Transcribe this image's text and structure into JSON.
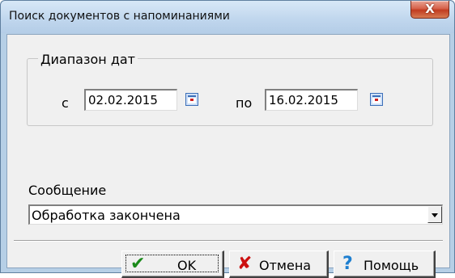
{
  "window": {
    "title": "Поиск документов с напоминаниями",
    "close_glyph": "X"
  },
  "date_range": {
    "group_label": "Диапазон дат",
    "from_label": "с",
    "from_value": "02.02.2015",
    "to_label": "по",
    "to_value": "16.02.2015",
    "calendar_icon": "calendar-icon"
  },
  "message": {
    "label": "Сообщение",
    "selected": "Обработка закончена"
  },
  "buttons": {
    "ok_label": "OK",
    "ok_icon": "check-icon",
    "ok_glyph": "✔",
    "cancel_label": "Отмена",
    "cancel_icon": "cross-icon",
    "cancel_glyph": "✘",
    "help_label": "Помощь",
    "help_icon": "question-icon",
    "help_glyph": "?"
  },
  "colors": {
    "title_bar": "#c1d7ee",
    "close_button": "#c13c21",
    "dialog_bg": "#f0f0f0",
    "ok_icon": "#1a8a1a",
    "cancel_icon": "#cc1010",
    "help_icon": "#1e7fd0"
  }
}
